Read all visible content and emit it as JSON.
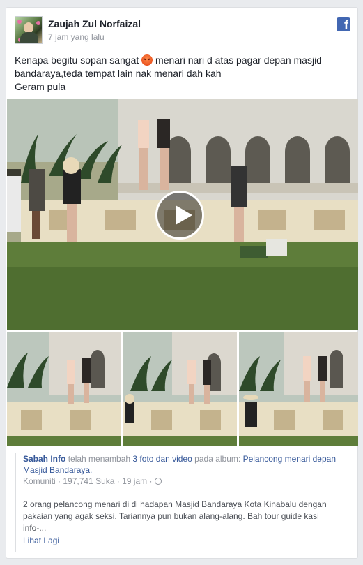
{
  "post": {
    "author": "Zaujah Zul Norfaizal",
    "time": "7 jam yang lalu",
    "text_line1_a": "Kenapa begitu sopan sangat",
    "text_line1_b": "menari nari d atas pagar depan masjid",
    "text_line2": "bandaraya,teda tempat lain nak menari dah kah",
    "text_line3": "Geram pula",
    "emoji": "angry-face-icon"
  },
  "attachment": {
    "page_name": "Sabah Info",
    "action_a": "telah menambah",
    "count_link": "3 foto dan video",
    "action_b": "pada album:",
    "album": "Pelancong menari depan Masjid Bandaraya.",
    "category": "Komuniti",
    "likes": "197,741 Suka",
    "time": "19 jam",
    "description": "2 orang pelancong menari di di hadapan Masjid Bandaraya Kota Kinabalu dengan pakaian yang agak seksi. Tariannya pun bukan alang-alang. Bah tour guide kasi info-...",
    "see_more": "Lihat Lagi"
  },
  "colors": {
    "facebook_blue": "#4267b2",
    "link": "#365899",
    "meta": "#90949c"
  }
}
